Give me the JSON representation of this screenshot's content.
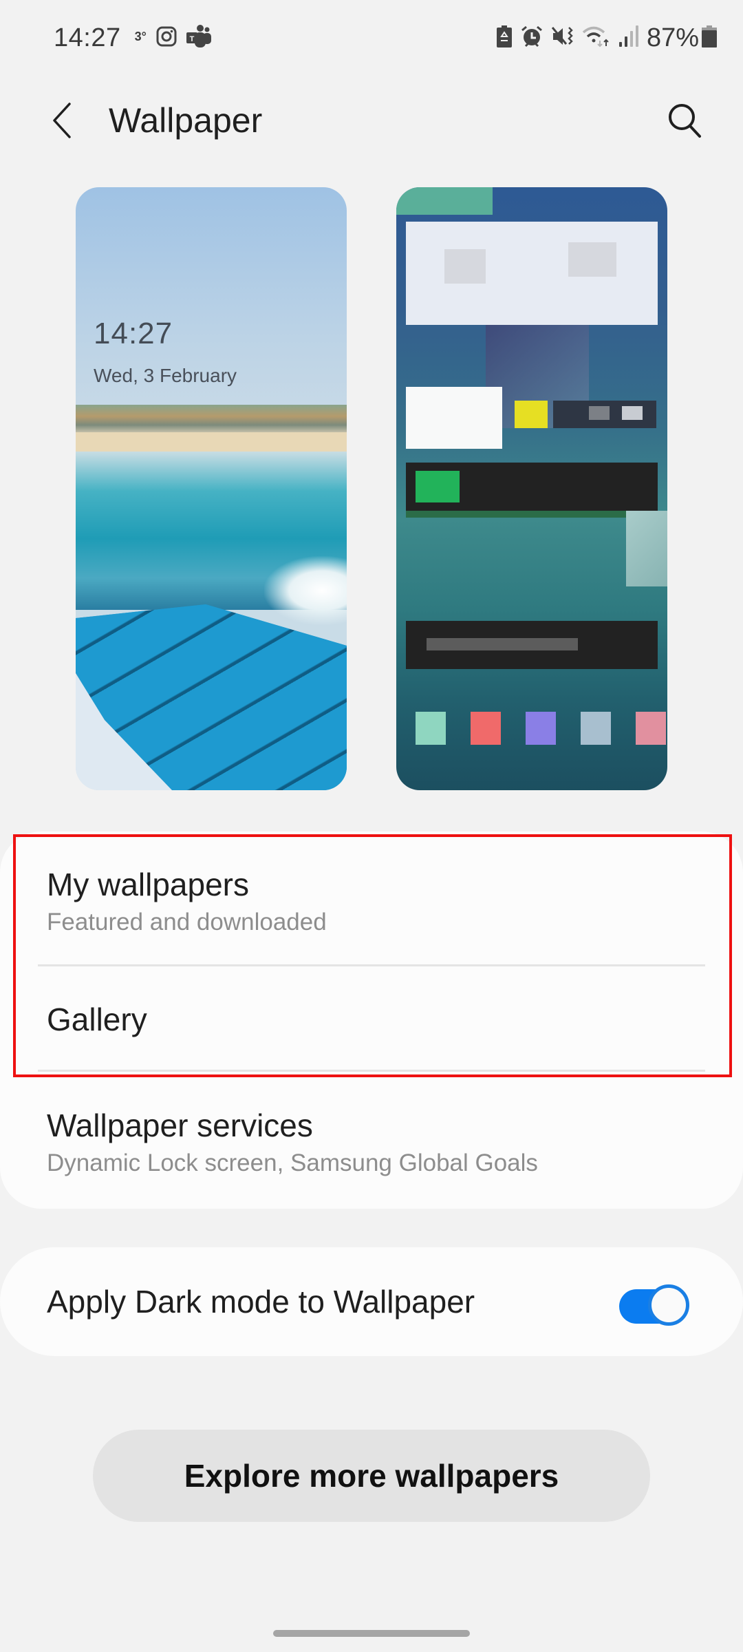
{
  "status_bar": {
    "time": "14:27",
    "temperature": "3°",
    "left_icons": [
      "instagram-icon",
      "teams-icon"
    ],
    "right_icons": [
      "battery-saver-icon",
      "alarm-icon",
      "mute-vibrate-icon",
      "wifi-icon",
      "signal-icon"
    ],
    "battery_percent": "87%"
  },
  "app_bar": {
    "title": "Wallpaper",
    "back_icon": "back-chevron-icon",
    "search_icon": "search-icon"
  },
  "previews": {
    "lock_screen": {
      "time": "14:27",
      "date": "Wed, 3 February"
    },
    "home_screen": {
      "pixelated": true
    }
  },
  "menu": {
    "items": [
      {
        "title": "My wallpapers",
        "subtitle": "Featured and downloaded"
      },
      {
        "title": "Gallery",
        "subtitle": ""
      },
      {
        "title": "Wallpaper services",
        "subtitle": "Dynamic Lock screen, Samsung Global Goals"
      }
    ],
    "highlight_color": "#ee1111"
  },
  "dark_mode": {
    "label": "Apply Dark mode to Wallpaper",
    "enabled": true,
    "accent": "#0b7cf0"
  },
  "explore_button": {
    "label": "Explore more wallpapers"
  }
}
